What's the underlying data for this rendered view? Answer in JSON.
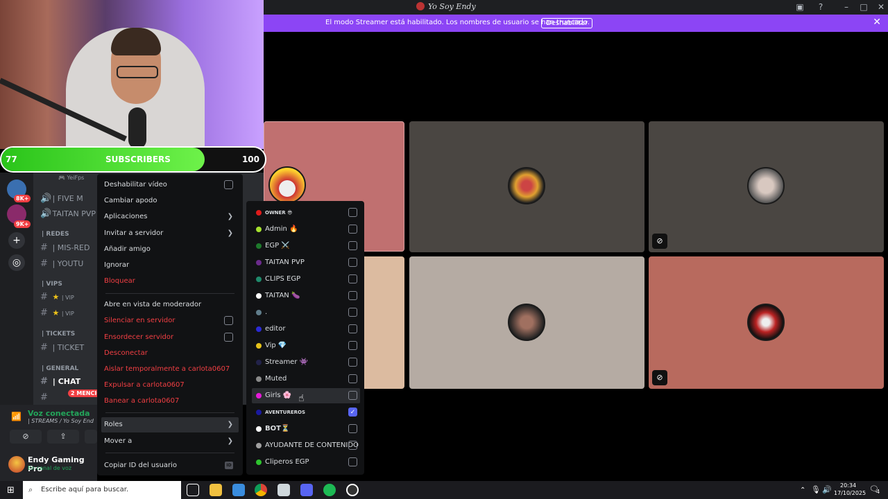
{
  "titlebar": {
    "title": "Yo Soy Endy"
  },
  "banner": {
    "message": "El modo Streamer está habilitado. Los nombres de usuario se han truncado.",
    "disable_label": "Deshabilitar"
  },
  "subscribers": {
    "current": "77",
    "label": "SUBSCRIBERS",
    "goal": "100",
    "progress_fraction": 0.77
  },
  "rail": {
    "badges": [
      "8K+",
      "9K+"
    ]
  },
  "channels": {
    "items": [
      {
        "type": "user",
        "label": "🎮 YeiFps"
      },
      {
        "type": "voice",
        "label": "| FIVE M"
      },
      {
        "type": "voice",
        "label": "TAITAN PVP"
      },
      {
        "type": "category",
        "label": "| REDES"
      },
      {
        "type": "text",
        "label": "| MIS-RED"
      },
      {
        "type": "text",
        "label": "| YOUTU"
      },
      {
        "type": "category",
        "label": "| VIPS"
      },
      {
        "type": "text",
        "label": "| VIP"
      },
      {
        "type": "text",
        "label": "| VIP"
      },
      {
        "type": "category",
        "label": "| TICKETS"
      },
      {
        "type": "text",
        "label": "| TICKET"
      },
      {
        "type": "category",
        "label": "| GENERAL"
      },
      {
        "type": "text",
        "label": "| CHAT"
      },
      {
        "type": "text",
        "label": ""
      }
    ],
    "mentions_badge": "2 MENCIO"
  },
  "voice": {
    "status": "Voz conectada",
    "location": "| STREAMS / Yo Soy End"
  },
  "user": {
    "name": "Endy Gaming Pro",
    "status": "En canal de voz"
  },
  "context_menu": {
    "items": [
      {
        "label": "Deshabilitar vídeo",
        "checkbox": true
      },
      {
        "label": "Cambiar apodo"
      },
      {
        "label": "Aplicaciones",
        "submenu": true
      },
      {
        "label": "Invitar a servidor",
        "submenu": true
      },
      {
        "label": "Añadir amigo"
      },
      {
        "label": "Ignorar"
      },
      {
        "label": "Bloquear",
        "danger": true
      },
      {
        "label": "Abre en vista de moderador"
      },
      {
        "label": "Silenciar en servidor",
        "danger": true,
        "checkbox": true
      },
      {
        "label": "Ensordecer servidor",
        "danger": true,
        "checkbox": true
      },
      {
        "label": "Desconectar",
        "danger": true
      },
      {
        "label": "Aislar temporalmente a carlota0607",
        "danger": true
      },
      {
        "label": "Expulsar a carlota0607",
        "danger": true
      },
      {
        "label": "Banear a carlota0607",
        "danger": true
      },
      {
        "label": "Roles",
        "submenu": true
      },
      {
        "label": "Mover a",
        "submenu": true
      },
      {
        "label": "Copiar ID del usuario"
      }
    ],
    "id_badge": "ID"
  },
  "roles": [
    {
      "name": "OWNER 😎",
      "color": "#e01b1b",
      "checked": false,
      "small": true
    },
    {
      "name": "Admin 🔥",
      "color": "#a6e22e",
      "checked": false
    },
    {
      "name": "EGP ⚔️",
      "color": "#1e7a2c",
      "checked": false
    },
    {
      "name": "TAITAN PVP",
      "color": "#6b2b8c",
      "checked": false
    },
    {
      "name": "CLIPS EGP",
      "color": "#1f8a6b",
      "checked": false
    },
    {
      "name": "TAITAN 🍆",
      "color": "#ffffff",
      "checked": false
    },
    {
      "name": ".",
      "color": "#607d8b",
      "checked": false
    },
    {
      "name": "editor",
      "color": "#2a2ad4",
      "checked": false
    },
    {
      "name": "Vip 💎",
      "color": "#e6c21a",
      "checked": false
    },
    {
      "name": "Streamer 👾",
      "color": "#22224a",
      "checked": false
    },
    {
      "name": "Muted",
      "color": "#8a8a8a",
      "checked": false
    },
    {
      "name": "Girls 🌸",
      "color": "#e61ad9",
      "checked": false
    },
    {
      "name": "AVENTUREROS",
      "color": "#1a1aa0",
      "checked": true,
      "small": true
    },
    {
      "name": "BOT⏳",
      "color": "#ffffff",
      "checked": false
    },
    {
      "name": "AYUDANTE DE CONTENIDO",
      "color": "#a0a0a0",
      "checked": false
    },
    {
      "name": "Cliperos EGP",
      "color": "#2ec42e",
      "checked": false
    }
  ],
  "taskbar": {
    "search_placeholder": "Escribe aquí para buscar.",
    "time": "20:34",
    "date": "17/10/2025",
    "notifications": "4"
  },
  "colors": {
    "accent": "#5865f2",
    "banner": "#8c45f5",
    "danger": "#f23f43",
    "online": "#23a55a"
  }
}
